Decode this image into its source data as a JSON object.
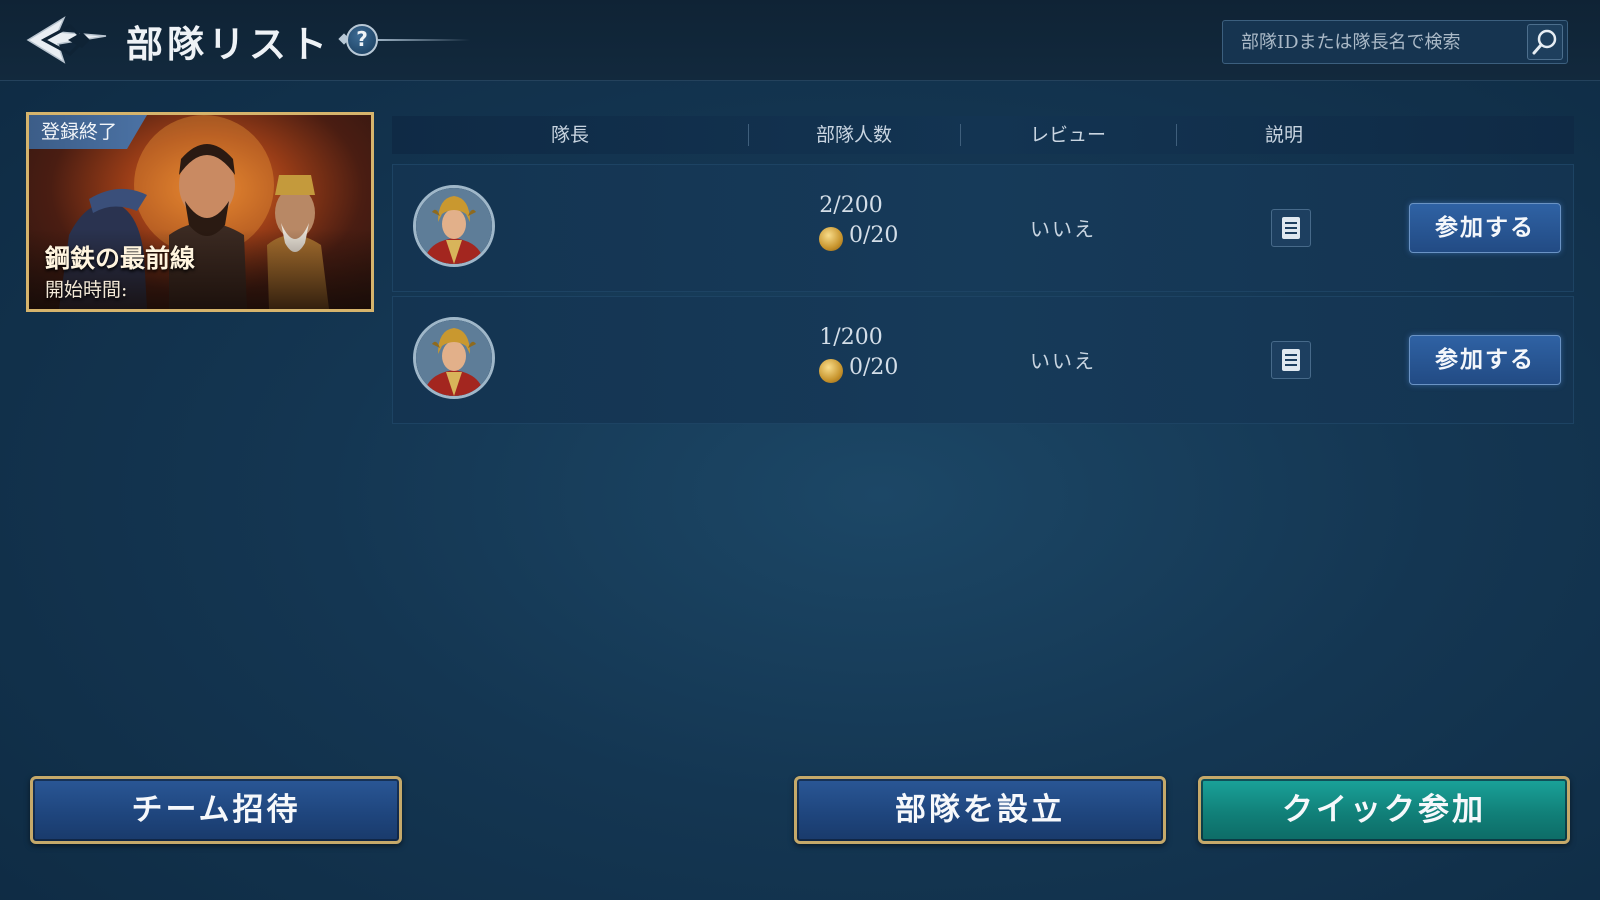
{
  "header": {
    "title": "部隊リスト",
    "help_icon": "?",
    "search": {
      "placeholder": "部隊IDまたは隊長名で検索"
    }
  },
  "event": {
    "tag": "登録終了",
    "title": "鋼鉄の最前線",
    "time_label": "開始時間:"
  },
  "table": {
    "columns": [
      "隊長",
      "部隊人数",
      "レビュー",
      "説明"
    ],
    "rows": [
      {
        "members": "2/200",
        "reserve": "0/20",
        "review": "いいえ",
        "join": "参加する"
      },
      {
        "members": "1/200",
        "reserve": "0/20",
        "review": "いいえ",
        "join": "参加する"
      }
    ]
  },
  "footer": {
    "invite": "チーム招待",
    "create": "部隊を設立",
    "quick_join": "クイック参加"
  },
  "colors": {
    "accent_gold": "#d6b46c",
    "join_blue": "#2f62a4",
    "quick_teal": "#1aa39a",
    "background": "#143652"
  }
}
